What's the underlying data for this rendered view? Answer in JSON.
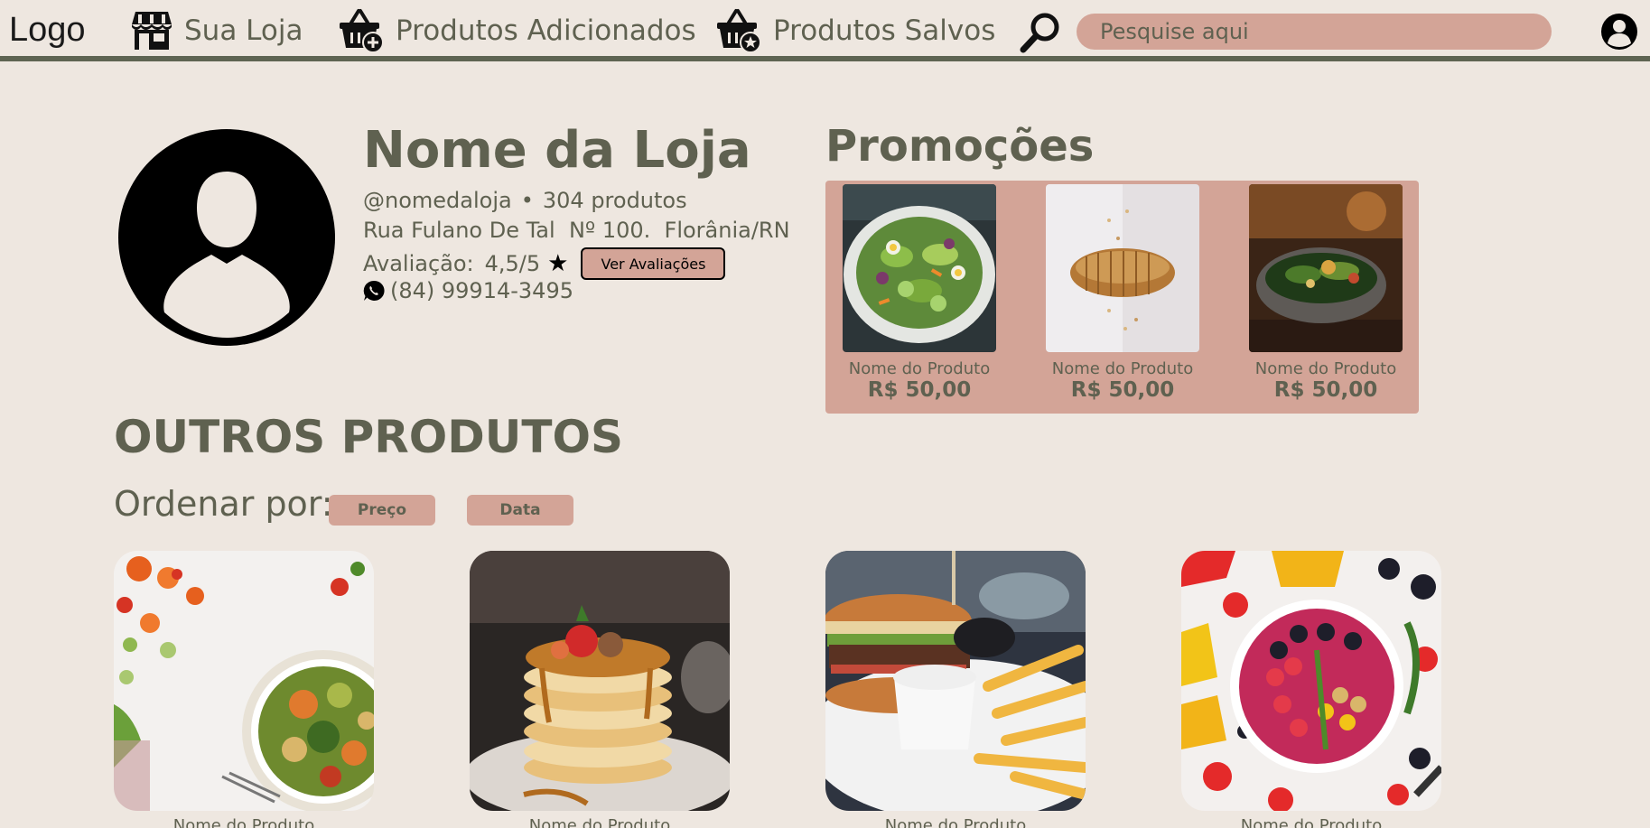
{
  "nav": {
    "logo": "Logo",
    "items": [
      {
        "label": "Sua Loja",
        "icon": "store-icon"
      },
      {
        "label": "Produtos Adicionados",
        "icon": "basket-add-icon"
      },
      {
        "label": "Produtos Salvos",
        "icon": "basket-star-icon"
      }
    ],
    "search_placeholder": "Pesquise aqui"
  },
  "store": {
    "name": "Nome da Loja",
    "handle": "@nomedaloja",
    "separator": "•",
    "product_count": "304 produtos",
    "address": "Rua Fulano De Tal  Nº 100.  Florânia/RN",
    "rating_label": "Avaliação:",
    "rating_value": "4,5/5",
    "reviews_button": "Ver Avaliações",
    "phone": "(84) 99914-3495"
  },
  "promotions": {
    "title": "Promoções",
    "items": [
      {
        "name": "Nome do Produto",
        "price": "R$ 50,00"
      },
      {
        "name": "Nome do Produto",
        "price": "R$ 50,00"
      },
      {
        "name": "Nome do Produto",
        "price": "R$ 50,00"
      }
    ]
  },
  "others": {
    "title": "OUTROS PRODUTOS",
    "sort_label": "Ordenar por:",
    "sort_options": [
      "Preço",
      "Data"
    ],
    "items": [
      {
        "name": "Nome do Produto"
      },
      {
        "name": "Nome do Produto"
      },
      {
        "name": "Nome do Produto"
      },
      {
        "name": "Nome do Produto"
      }
    ]
  },
  "colors": {
    "background": "#EEE7E0",
    "accent": "#D3A497",
    "text": "#5F6150",
    "nav_border": "#5E6452"
  }
}
